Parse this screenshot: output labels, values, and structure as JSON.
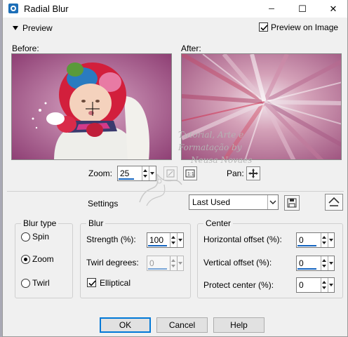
{
  "window": {
    "title": "Radial Blur",
    "minimize_glyph": "─",
    "maximize_glyph": "☐",
    "close_glyph": "✕",
    "app_icon": "paintshop-icon"
  },
  "preview": {
    "toggle_label": "Preview",
    "on_image_label": "Preview on Image",
    "on_image_checked": true
  },
  "panes": {
    "before_label": "Before:",
    "after_label": "After:"
  },
  "zoom": {
    "label": "Zoom:",
    "value": "25",
    "pan_label": "Pan:"
  },
  "watermark": {
    "line1": "Tutorial, Arte e",
    "line2": "Formatação by",
    "line3": "Neusa Novaes"
  },
  "settings": {
    "label": "Settings",
    "preset": "Last Used"
  },
  "blur_type": {
    "title": "Blur type",
    "options": [
      "Spin",
      "Zoom",
      "Twirl"
    ],
    "selected": "Zoom"
  },
  "blur": {
    "title": "Blur",
    "strength_label": "Strength (%):",
    "strength_value": "100",
    "twirl_label": "Twirl degrees:",
    "twirl_value": "0",
    "elliptical_label": "Elliptical",
    "elliptical_checked": true
  },
  "center": {
    "title": "Center",
    "horizontal_label": "Horizontal offset (%):",
    "horizontal_value": "0",
    "vertical_label": "Vertical offset (%):",
    "vertical_value": "0",
    "protect_label": "Protect center (%):",
    "protect_value": "0"
  },
  "buttons": {
    "ok": "OK",
    "cancel": "Cancel",
    "help": "Help"
  },
  "colors": {
    "accent": "#0078d7",
    "preview_bg": "#b0648f"
  }
}
